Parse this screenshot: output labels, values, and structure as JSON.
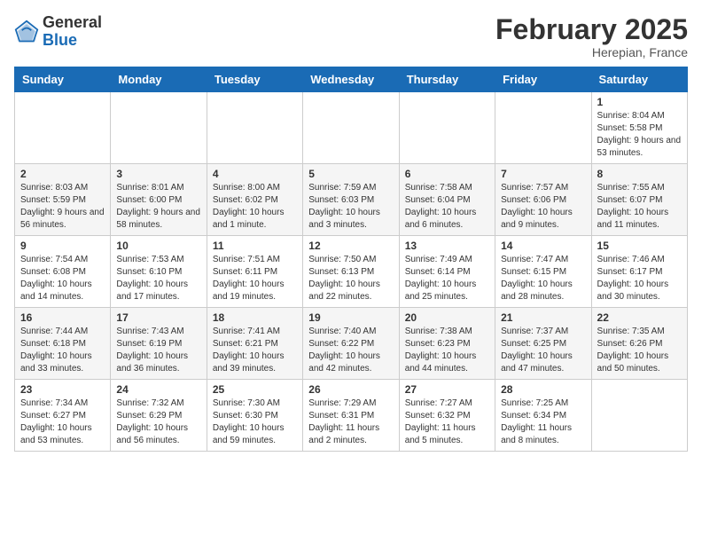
{
  "logo": {
    "general": "General",
    "blue": "Blue"
  },
  "header": {
    "month_year": "February 2025",
    "location": "Herepian, France"
  },
  "weekdays": [
    "Sunday",
    "Monday",
    "Tuesday",
    "Wednesday",
    "Thursday",
    "Friday",
    "Saturday"
  ],
  "weeks": [
    [
      null,
      null,
      null,
      null,
      null,
      null,
      {
        "day": "1",
        "sunrise": "Sunrise: 8:04 AM",
        "sunset": "Sunset: 5:58 PM",
        "daylight": "Daylight: 9 hours and 53 minutes."
      }
    ],
    [
      {
        "day": "2",
        "sunrise": "Sunrise: 8:03 AM",
        "sunset": "Sunset: 5:59 PM",
        "daylight": "Daylight: 9 hours and 56 minutes."
      },
      {
        "day": "3",
        "sunrise": "Sunrise: 8:01 AM",
        "sunset": "Sunset: 6:00 PM",
        "daylight": "Daylight: 9 hours and 58 minutes."
      },
      {
        "day": "4",
        "sunrise": "Sunrise: 8:00 AM",
        "sunset": "Sunset: 6:02 PM",
        "daylight": "Daylight: 10 hours and 1 minute."
      },
      {
        "day": "5",
        "sunrise": "Sunrise: 7:59 AM",
        "sunset": "Sunset: 6:03 PM",
        "daylight": "Daylight: 10 hours and 3 minutes."
      },
      {
        "day": "6",
        "sunrise": "Sunrise: 7:58 AM",
        "sunset": "Sunset: 6:04 PM",
        "daylight": "Daylight: 10 hours and 6 minutes."
      },
      {
        "day": "7",
        "sunrise": "Sunrise: 7:57 AM",
        "sunset": "Sunset: 6:06 PM",
        "daylight": "Daylight: 10 hours and 9 minutes."
      },
      {
        "day": "8",
        "sunrise": "Sunrise: 7:55 AM",
        "sunset": "Sunset: 6:07 PM",
        "daylight": "Daylight: 10 hours and 11 minutes."
      }
    ],
    [
      {
        "day": "9",
        "sunrise": "Sunrise: 7:54 AM",
        "sunset": "Sunset: 6:08 PM",
        "daylight": "Daylight: 10 hours and 14 minutes."
      },
      {
        "day": "10",
        "sunrise": "Sunrise: 7:53 AM",
        "sunset": "Sunset: 6:10 PM",
        "daylight": "Daylight: 10 hours and 17 minutes."
      },
      {
        "day": "11",
        "sunrise": "Sunrise: 7:51 AM",
        "sunset": "Sunset: 6:11 PM",
        "daylight": "Daylight: 10 hours and 19 minutes."
      },
      {
        "day": "12",
        "sunrise": "Sunrise: 7:50 AM",
        "sunset": "Sunset: 6:13 PM",
        "daylight": "Daylight: 10 hours and 22 minutes."
      },
      {
        "day": "13",
        "sunrise": "Sunrise: 7:49 AM",
        "sunset": "Sunset: 6:14 PM",
        "daylight": "Daylight: 10 hours and 25 minutes."
      },
      {
        "day": "14",
        "sunrise": "Sunrise: 7:47 AM",
        "sunset": "Sunset: 6:15 PM",
        "daylight": "Daylight: 10 hours and 28 minutes."
      },
      {
        "day": "15",
        "sunrise": "Sunrise: 7:46 AM",
        "sunset": "Sunset: 6:17 PM",
        "daylight": "Daylight: 10 hours and 30 minutes."
      }
    ],
    [
      {
        "day": "16",
        "sunrise": "Sunrise: 7:44 AM",
        "sunset": "Sunset: 6:18 PM",
        "daylight": "Daylight: 10 hours and 33 minutes."
      },
      {
        "day": "17",
        "sunrise": "Sunrise: 7:43 AM",
        "sunset": "Sunset: 6:19 PM",
        "daylight": "Daylight: 10 hours and 36 minutes."
      },
      {
        "day": "18",
        "sunrise": "Sunrise: 7:41 AM",
        "sunset": "Sunset: 6:21 PM",
        "daylight": "Daylight: 10 hours and 39 minutes."
      },
      {
        "day": "19",
        "sunrise": "Sunrise: 7:40 AM",
        "sunset": "Sunset: 6:22 PM",
        "daylight": "Daylight: 10 hours and 42 minutes."
      },
      {
        "day": "20",
        "sunrise": "Sunrise: 7:38 AM",
        "sunset": "Sunset: 6:23 PM",
        "daylight": "Daylight: 10 hours and 44 minutes."
      },
      {
        "day": "21",
        "sunrise": "Sunrise: 7:37 AM",
        "sunset": "Sunset: 6:25 PM",
        "daylight": "Daylight: 10 hours and 47 minutes."
      },
      {
        "day": "22",
        "sunrise": "Sunrise: 7:35 AM",
        "sunset": "Sunset: 6:26 PM",
        "daylight": "Daylight: 10 hours and 50 minutes."
      }
    ],
    [
      {
        "day": "23",
        "sunrise": "Sunrise: 7:34 AM",
        "sunset": "Sunset: 6:27 PM",
        "daylight": "Daylight: 10 hours and 53 minutes."
      },
      {
        "day": "24",
        "sunrise": "Sunrise: 7:32 AM",
        "sunset": "Sunset: 6:29 PM",
        "daylight": "Daylight: 10 hours and 56 minutes."
      },
      {
        "day": "25",
        "sunrise": "Sunrise: 7:30 AM",
        "sunset": "Sunset: 6:30 PM",
        "daylight": "Daylight: 10 hours and 59 minutes."
      },
      {
        "day": "26",
        "sunrise": "Sunrise: 7:29 AM",
        "sunset": "Sunset: 6:31 PM",
        "daylight": "Daylight: 11 hours and 2 minutes."
      },
      {
        "day": "27",
        "sunrise": "Sunrise: 7:27 AM",
        "sunset": "Sunset: 6:32 PM",
        "daylight": "Daylight: 11 hours and 5 minutes."
      },
      {
        "day": "28",
        "sunrise": "Sunrise: 7:25 AM",
        "sunset": "Sunset: 6:34 PM",
        "daylight": "Daylight: 11 hours and 8 minutes."
      },
      null
    ]
  ]
}
